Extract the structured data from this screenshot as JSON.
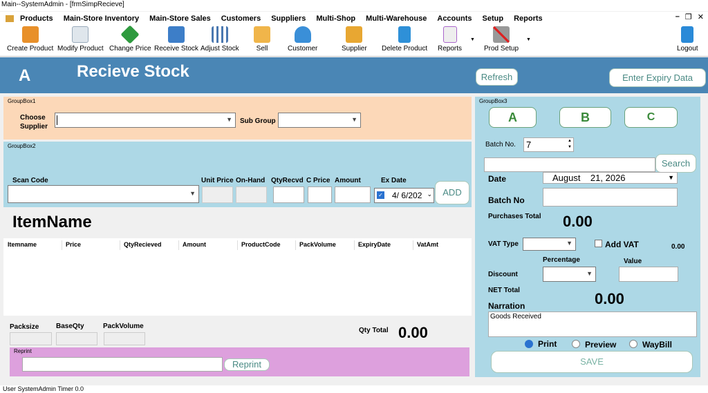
{
  "window": {
    "title": "Main--SystemAdmin - [frmSimpRecieve]"
  },
  "menu": [
    "Products",
    "Main-Store Inventory",
    "Main-Store Sales",
    "Customers",
    "Suppliers",
    "Multi-Shop",
    "Multi-Warehouse",
    "Accounts",
    "Setup",
    "Reports"
  ],
  "toolbar": {
    "create_product": "Create Product",
    "modify_product": "Modify Product",
    "change_price": "Change Price",
    "receive_stock": "Receive Stock",
    "adjust_stock": "Adjust Stock",
    "sell": "Sell",
    "customer": "Customer",
    "supplier": "Supplier",
    "delete_product": "Delete Product",
    "reports": "Reports",
    "prod_setup": "Prod Setup",
    "logout": "Logout"
  },
  "header": {
    "letter": "A",
    "title": "Recieve Stock",
    "refresh": "Refresh",
    "enter_expiry": "Enter Expiry Data"
  },
  "gb1": {
    "label": "GroupBox1",
    "choose_supplier": "Choose Supplier",
    "sub_group": "Sub Group"
  },
  "gb2": {
    "label": "GroupBox2",
    "scan_code": "Scan Code",
    "unit_price": "Unit Price",
    "on_hand": "On-Hand",
    "qty_recvd": "QtyRecvd",
    "c_price": "C Price",
    "amount": "Amount",
    "ex_date": "Ex Date",
    "ex_date_value": "4/  6/202",
    "add": "ADD"
  },
  "item_name": "ItemName",
  "grid": {
    "columns": [
      "Itemname",
      "Price",
      "QtyRecieved",
      "Amount",
      "ProductCode",
      "PackVolume",
      "ExpiryDate",
      "VatAmt"
    ]
  },
  "bottom": {
    "packsize": "Packsize",
    "baseqty": "BaseQty",
    "packvolume": "PackVolume",
    "qty_total_label": "Qty Total",
    "qty_total": "0.00"
  },
  "reprint": {
    "label": "Reprint",
    "button": "Reprint"
  },
  "gb3": {
    "label": "GroupBox3",
    "btn_a": "A",
    "btn_b": "B",
    "btn_c": "C",
    "batch_label": "Batch No.",
    "batch_value": "7",
    "search": "Search",
    "date_label": "Date",
    "date_value": "August    21, 2026",
    "batch_no": "Batch No",
    "purchases_total_label": "Purchases Total",
    "purchases_total": "0.00",
    "vat_type": "VAT Type",
    "add_vat": "Add VAT",
    "vat_value": "0.00",
    "percentage": "Percentage",
    "value": "Value",
    "discount": "Discount",
    "net_total_label": "NET Total",
    "net_total": "0.00",
    "narration": "Narration",
    "narration_text": "Goods Received",
    "print": "Print",
    "preview": "Preview",
    "waybill": "WayBill",
    "save": "SAVE"
  },
  "status": "User  SystemAdmin   Timer  0.0",
  "colors": {
    "header": "#4a86b5",
    "gb1": "#fcd8b8",
    "gb2": "#add8e6",
    "reprint": "#dda0dd"
  }
}
